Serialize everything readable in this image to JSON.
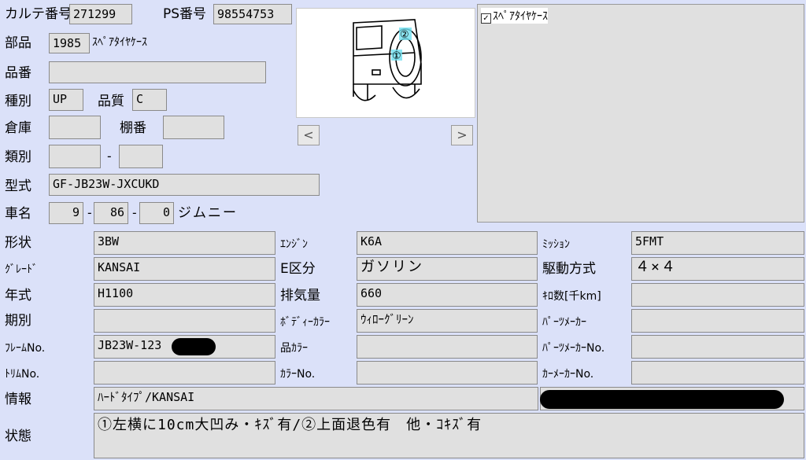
{
  "karte": {
    "label": "カルテ番号",
    "value": "271299"
  },
  "ps": {
    "label": "PS番号",
    "value": "98554753"
  },
  "buhin": {
    "label": "部品",
    "code": "1985",
    "name": "ｽﾍﾟｱﾀｲﾔｹｰｽ"
  },
  "hinban": {
    "label": "品番",
    "value": ""
  },
  "shubetsu": {
    "label": "種別",
    "value": "UP"
  },
  "hinshitsu": {
    "label": "品質",
    "value": "C"
  },
  "souko": {
    "label": "倉庫",
    "value": ""
  },
  "tanaban": {
    "label": "棚番",
    "value": ""
  },
  "ruibetsu": {
    "label": "類別",
    "value1": "",
    "sep": "-",
    "value2": ""
  },
  "katashiki": {
    "label": "型式",
    "value": "GF-JB23W-JXCUKD"
  },
  "shamei": {
    "label": "車名",
    "v1": "9",
    "v2": "86",
    "v3": "0",
    "sep": "-",
    "name": "ジムニー"
  },
  "image_nav": {
    "prev": "<",
    "next": ">"
  },
  "right_panel": {
    "checkbox_label": "ｽﾍﾟｱﾀｲﾔｹｰｽ",
    "checked": true,
    "check_mark": "✓"
  },
  "image_markers": {
    "m1": "①",
    "m2": "②"
  },
  "specs": {
    "keijou": {
      "label": "形状",
      "value": "3BW"
    },
    "engine": {
      "label": "ｴﾝｼﾞﾝ",
      "value": "K6A"
    },
    "mission": {
      "label": "ﾐｯｼｮﾝ",
      "value": "5FMT"
    },
    "grade": {
      "label": "ｸﾞﾚｰﾄﾞ",
      "value": "KANSAI"
    },
    "ekubun": {
      "label": "E区分",
      "value": "ガソリン"
    },
    "kudou": {
      "label": "駆動方式",
      "value": "４×４"
    },
    "nenshiki": {
      "label": "年式",
      "value": "H1100"
    },
    "haikiryou": {
      "label": "排気量",
      "value": "660"
    },
    "kirosu": {
      "label": "ｷﾛ数[千km]",
      "value": ""
    },
    "kibetsu": {
      "label": "期別",
      "value": ""
    },
    "bodycolor": {
      "label": "ﾎﾞﾃﾞｨｰｶﾗｰ",
      "value": "ｳｨﾛｰｸﾞﾘｰﾝ"
    },
    "partsmaker": {
      "label": "ﾊﾟｰﾂﾒｰｶｰ",
      "value": ""
    },
    "frameno": {
      "label": "ﾌﾚｰﾑNo.",
      "value": "JB23W-123"
    },
    "hincolor": {
      "label": "品ｶﾗｰ",
      "value": ""
    },
    "partsmakerno": {
      "label": "ﾊﾟｰﾂﾒｰｶｰNo.",
      "value": ""
    },
    "torimuno": {
      "label": "ﾄﾘﾑNo.",
      "value": ""
    },
    "colorno": {
      "label": "ｶﾗｰNo.",
      "value": ""
    },
    "carmakerno": {
      "label": "ｶｰﾒｰｶｰNo.",
      "value": ""
    }
  },
  "jouhou": {
    "label": "情報",
    "value": "ﾊｰﾄﾞﾀｲﾌﾟ/KANSAI"
  },
  "joutai": {
    "label": "状態",
    "value": "①左横に10cm大凹み・ｷｽﾞ有/②上面退色有　他・ｺｷｽﾞ有"
  }
}
